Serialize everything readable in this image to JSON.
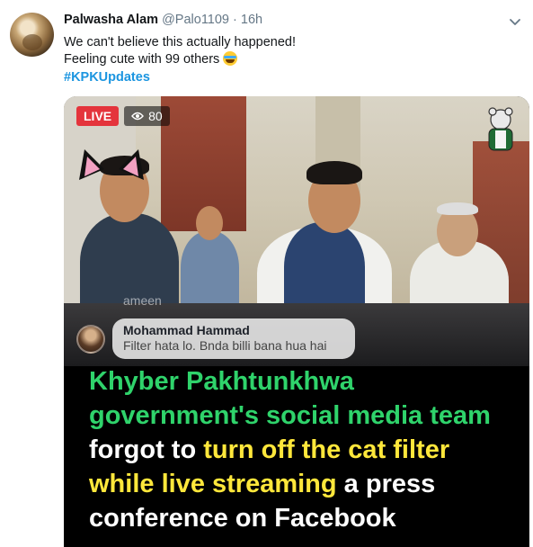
{
  "tweet": {
    "author_name": "Palwasha Alam",
    "author_handle": "@Palo1109",
    "separator": "·",
    "time": "16h",
    "line1": "We can't believe this actually happened!",
    "line2": "Feeling cute with 99 others",
    "hashtag": "#KPKUpdates"
  },
  "media": {
    "live_label": "LIVE",
    "viewer_count": "80",
    "faded_comment": "ameen",
    "comment": {
      "name": "Mohammad Hammad",
      "text": "Filter hata lo. Bnda billi bana hua hai"
    },
    "caption": {
      "part1_green": "Khyber Pakhtunkhwa government's social media team",
      "part2_white": " forgot to ",
      "part3_yellow": "turn off the cat filter while live streaming",
      "part4_white": " a press conference on Facebook"
    }
  },
  "icons": {
    "chevron": "chevron-down-icon",
    "eye": "eye-icon",
    "emoji": "tears-of-joy-emoji-icon"
  },
  "colors": {
    "hashtag": "#1b95e0",
    "live_red": "#e4343c",
    "caption_green": "#2fd36b",
    "caption_yellow": "#ffe73b"
  }
}
